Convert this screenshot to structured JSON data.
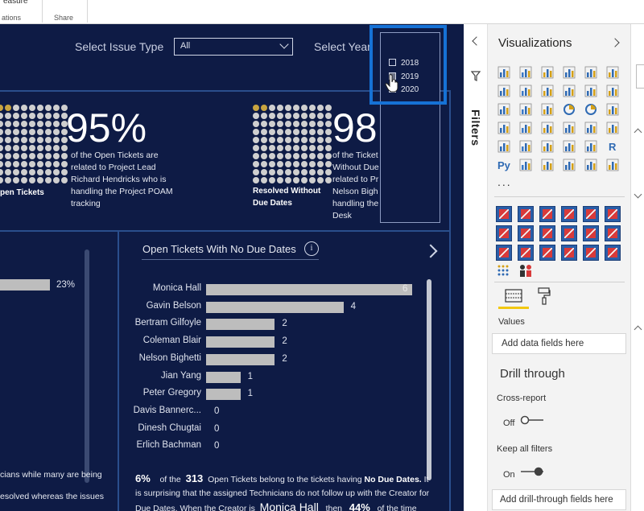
{
  "ribbon": {
    "measure_label": "easure",
    "group_calculations": "ations",
    "group_share": "Share"
  },
  "filters_bar": {
    "issue_type_label": "Select Issue Type",
    "issue_type_value": "All",
    "year_label": "Select Year",
    "year_value": "2019"
  },
  "year_dropdown": {
    "options": [
      {
        "label": "2018",
        "checked": false
      },
      {
        "label": "2019",
        "checked": true
      },
      {
        "label": "2020",
        "checked": false
      }
    ]
  },
  "cards": [
    {
      "label": "pen Tickets",
      "pct": "95%",
      "desc": [
        "of the Open Tickets are",
        "related to Project Lead",
        "Richard Hendricks who is",
        "handling the Project POAM",
        "tracking"
      ]
    },
    {
      "label": [
        "Resolved Without",
        "Due Dates"
      ],
      "pct": "98",
      "desc": [
        "of the Ticket",
        "Without Due",
        "related to Pr",
        "Nelson Bigh",
        "handling the",
        "Desk"
      ]
    }
  ],
  "left_chart": {
    "value_label": "23%",
    "footer": [
      "cians while many are being",
      "esolved whereas the issues"
    ]
  },
  "chart_data": {
    "type": "bar",
    "title": "Open Tickets With No Due Dates",
    "categories": [
      "Monica Hall",
      "Gavin Belson",
      "Bertram Gilfoyle",
      "Coleman Blair",
      "Nelson Bighetti",
      "Jian Yang",
      "Peter Gregory",
      "Davis Bannerc...",
      "Dinesh Chugtai",
      "Erlich Bachman"
    ],
    "values": [
      6,
      4,
      2,
      2,
      2,
      1,
      1,
      0,
      0,
      0
    ],
    "xlim": [
      0,
      6
    ],
    "orientation": "horizontal"
  },
  "chart_labels": [
    "6",
    "4",
    "2",
    "2",
    "2",
    "1",
    "1",
    "0",
    "0",
    "0"
  ],
  "chart_footer": {
    "pct": "6%",
    "t1": "of the",
    "count": "313",
    "t2": "Open Tickets belong to the tickets having",
    "bold": "No Due Dates.",
    "t3": "It",
    "line2": "is surprising that the assigned Technicians do not follow up with the Creator for",
    "line3a": "Due Dates. When the Creator is",
    "name": "Monica Hall",
    "line3b": "then",
    "pct2": "44%",
    "line3c": "of the time"
  },
  "filters_pane": {
    "label": "Filters"
  },
  "viz_pane": {
    "title": "Visualizations",
    "values_label": "Values",
    "add_data_fields": "Add data fields here",
    "drill_through": "Drill through",
    "cross_report": "Cross-report",
    "cross_report_state": "Off",
    "keep_all_filters": "Keep all filters",
    "keep_all_filters_state": "On",
    "add_drill_fields": "Add drill-through fields here",
    "more": "...",
    "colors": {
      "accent": "#f2c811",
      "icon_blue": "#3b6fb6",
      "toggle": "#404040"
    }
  }
}
